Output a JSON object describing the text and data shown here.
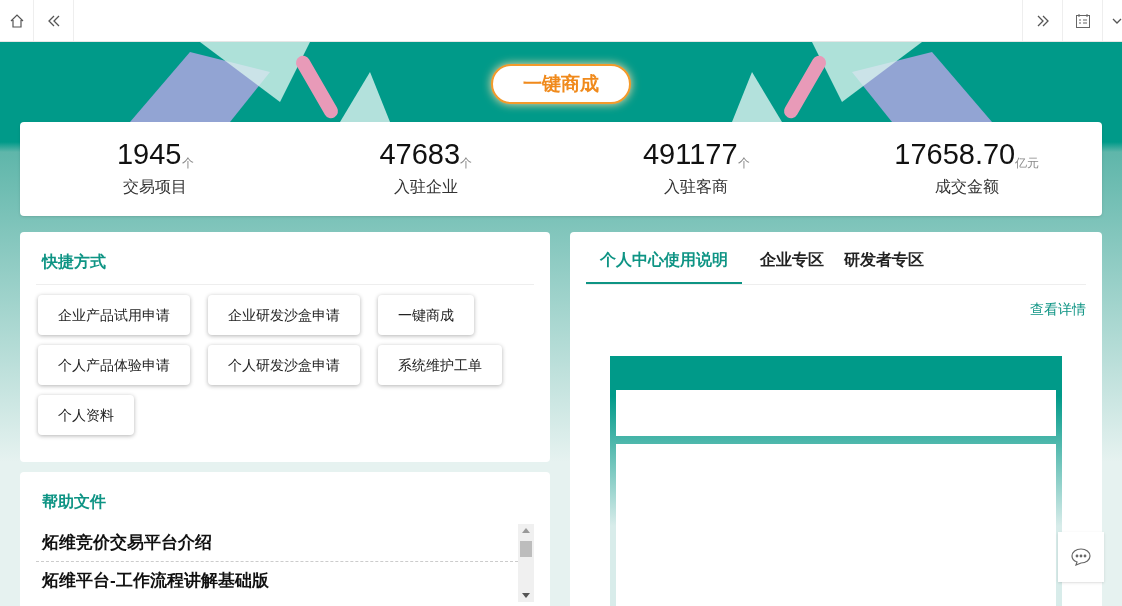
{
  "hero": {
    "button": "一键商成"
  },
  "stats": [
    {
      "value": "1945",
      "unit": "个",
      "label": "交易项目"
    },
    {
      "value": "47683",
      "unit": "个",
      "label": "入驻企业"
    },
    {
      "value": "491177",
      "unit": "个",
      "label": "入驻客商"
    },
    {
      "value": "17658.70",
      "unit": "亿元",
      "label": "成交金额"
    }
  ],
  "shortcuts": {
    "title": "快捷方式",
    "items": [
      "企业产品试用申请",
      "企业研发沙盒申请",
      "一键商成",
      "个人产品体验申请",
      "个人研发沙盒申请",
      "系统维护工单",
      "个人资料"
    ]
  },
  "help": {
    "title": "帮助文件",
    "items": [
      "炻维竞价交易平台介绍",
      "炻维平台-工作流程讲解基础版"
    ]
  },
  "guide": {
    "tabs": [
      {
        "label": "个人中心使用说明",
        "selected": true
      },
      {
        "label": "企业专区",
        "selected": false
      },
      {
        "label": "研发者专区",
        "selected": false
      }
    ],
    "link": "查看详情"
  }
}
